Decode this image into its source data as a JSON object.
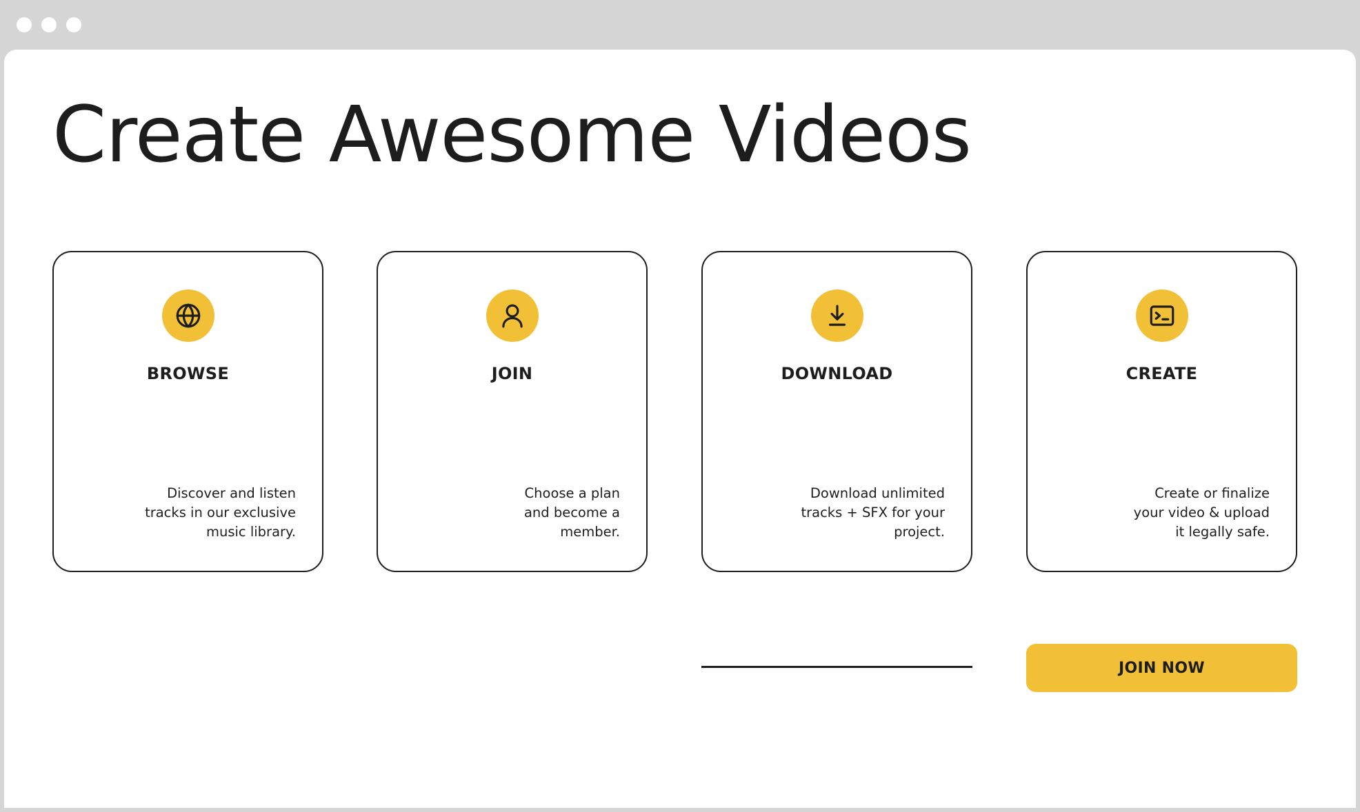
{
  "window": {
    "controls": [
      "window-dot",
      "window-dot",
      "window-dot"
    ]
  },
  "page": {
    "title": "Create Awesome Videos"
  },
  "cards": [
    {
      "icon": "globe-icon",
      "title": "BROWSE",
      "description": "Discover and listen\ntracks in our exclusive\nmusic library."
    },
    {
      "icon": "user-icon",
      "title": "JOIN",
      "description": "Choose a plan\nand become a\nmember."
    },
    {
      "icon": "download-icon",
      "title": "DOWNLOAD",
      "description": "Download unlimited\ntracks + SFX for your\nproject."
    },
    {
      "icon": "terminal-icon",
      "title": "CREATE",
      "description": "Create or finalize\nyour video & upload\nit legally safe."
    }
  ],
  "cta": {
    "label": "JOIN NOW"
  },
  "colors": {
    "accent": "#f2c037",
    "text": "#1d1d1d",
    "frame": "#d6d6d6",
    "background": "#ffffff"
  }
}
